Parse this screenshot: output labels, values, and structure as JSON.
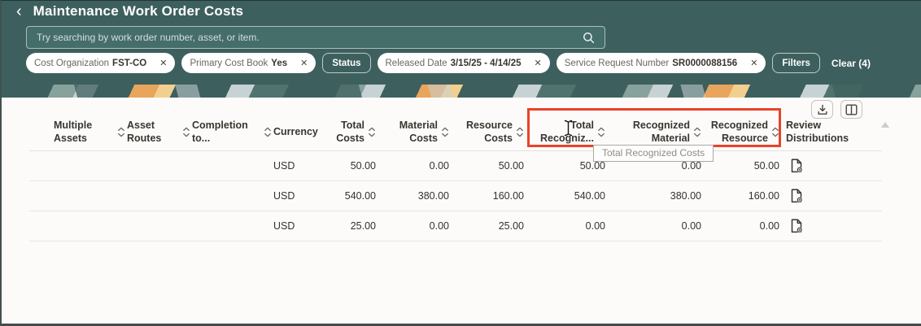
{
  "header": {
    "back_label": "‹",
    "title": "Maintenance Work Order Costs",
    "search": {
      "placeholder": "Try searching by work order number, asset, or item.",
      "value": ""
    },
    "chips": [
      {
        "label": "Cost Organization",
        "value": "FST-CO",
        "remove_icon": "✕"
      },
      {
        "label": "Primary Cost Book",
        "value": "Yes",
        "remove_icon": "✕"
      },
      {
        "label": "Released Date",
        "value": "3/15/25 - 4/14/25",
        "remove_icon": "✕"
      },
      {
        "label": "Service Request Number",
        "value": "SR0000088156",
        "remove_icon": "✕"
      }
    ],
    "status_chip_label": "Status",
    "filters_button_label": "Filters",
    "clear_button_label": "Clear (4)"
  },
  "table": {
    "columns": [
      {
        "label": "Multiple Assets",
        "sortable": true
      },
      {
        "label": "Asset Routes",
        "sortable": true
      },
      {
        "label": "Completion to...",
        "sortable": true
      },
      {
        "label": "Currency",
        "sortable": false
      },
      {
        "label": "Total Costs",
        "sortable": true
      },
      {
        "label": "Material Costs",
        "sortable": true
      },
      {
        "label": "Resource Costs",
        "sortable": true
      },
      {
        "label": "Total Recogniz...",
        "sortable": true
      },
      {
        "label": "Recognized Material",
        "sortable": true
      },
      {
        "label": "Recognized Resource",
        "sortable": true
      },
      {
        "label": "Review Distributions",
        "sortable": false
      }
    ],
    "rows": [
      {
        "currency": "USD",
        "total_costs": "50.00",
        "material_costs": "0.00",
        "resource_costs": "50.00",
        "total_recognized": "50.00",
        "recognized_material": "0.00",
        "recognized_resource": "50.00"
      },
      {
        "currency": "USD",
        "total_costs": "540.00",
        "material_costs": "380.00",
        "resource_costs": "160.00",
        "total_recognized": "540.00",
        "recognized_material": "380.00",
        "recognized_resource": "160.00"
      },
      {
        "currency": "USD",
        "total_costs": "25.00",
        "material_costs": "0.00",
        "resource_costs": "25.00",
        "total_recognized": "0.00",
        "recognized_material": "0.00",
        "recognized_resource": "0.00"
      }
    ]
  },
  "tooltip": {
    "text": "Total Recognized Costs"
  },
  "colors": {
    "header_bg": "#3D605E",
    "highlight_red": "#E8432B",
    "accent_orange": "#E9A55B",
    "content_bg": "#FCFBFA"
  }
}
